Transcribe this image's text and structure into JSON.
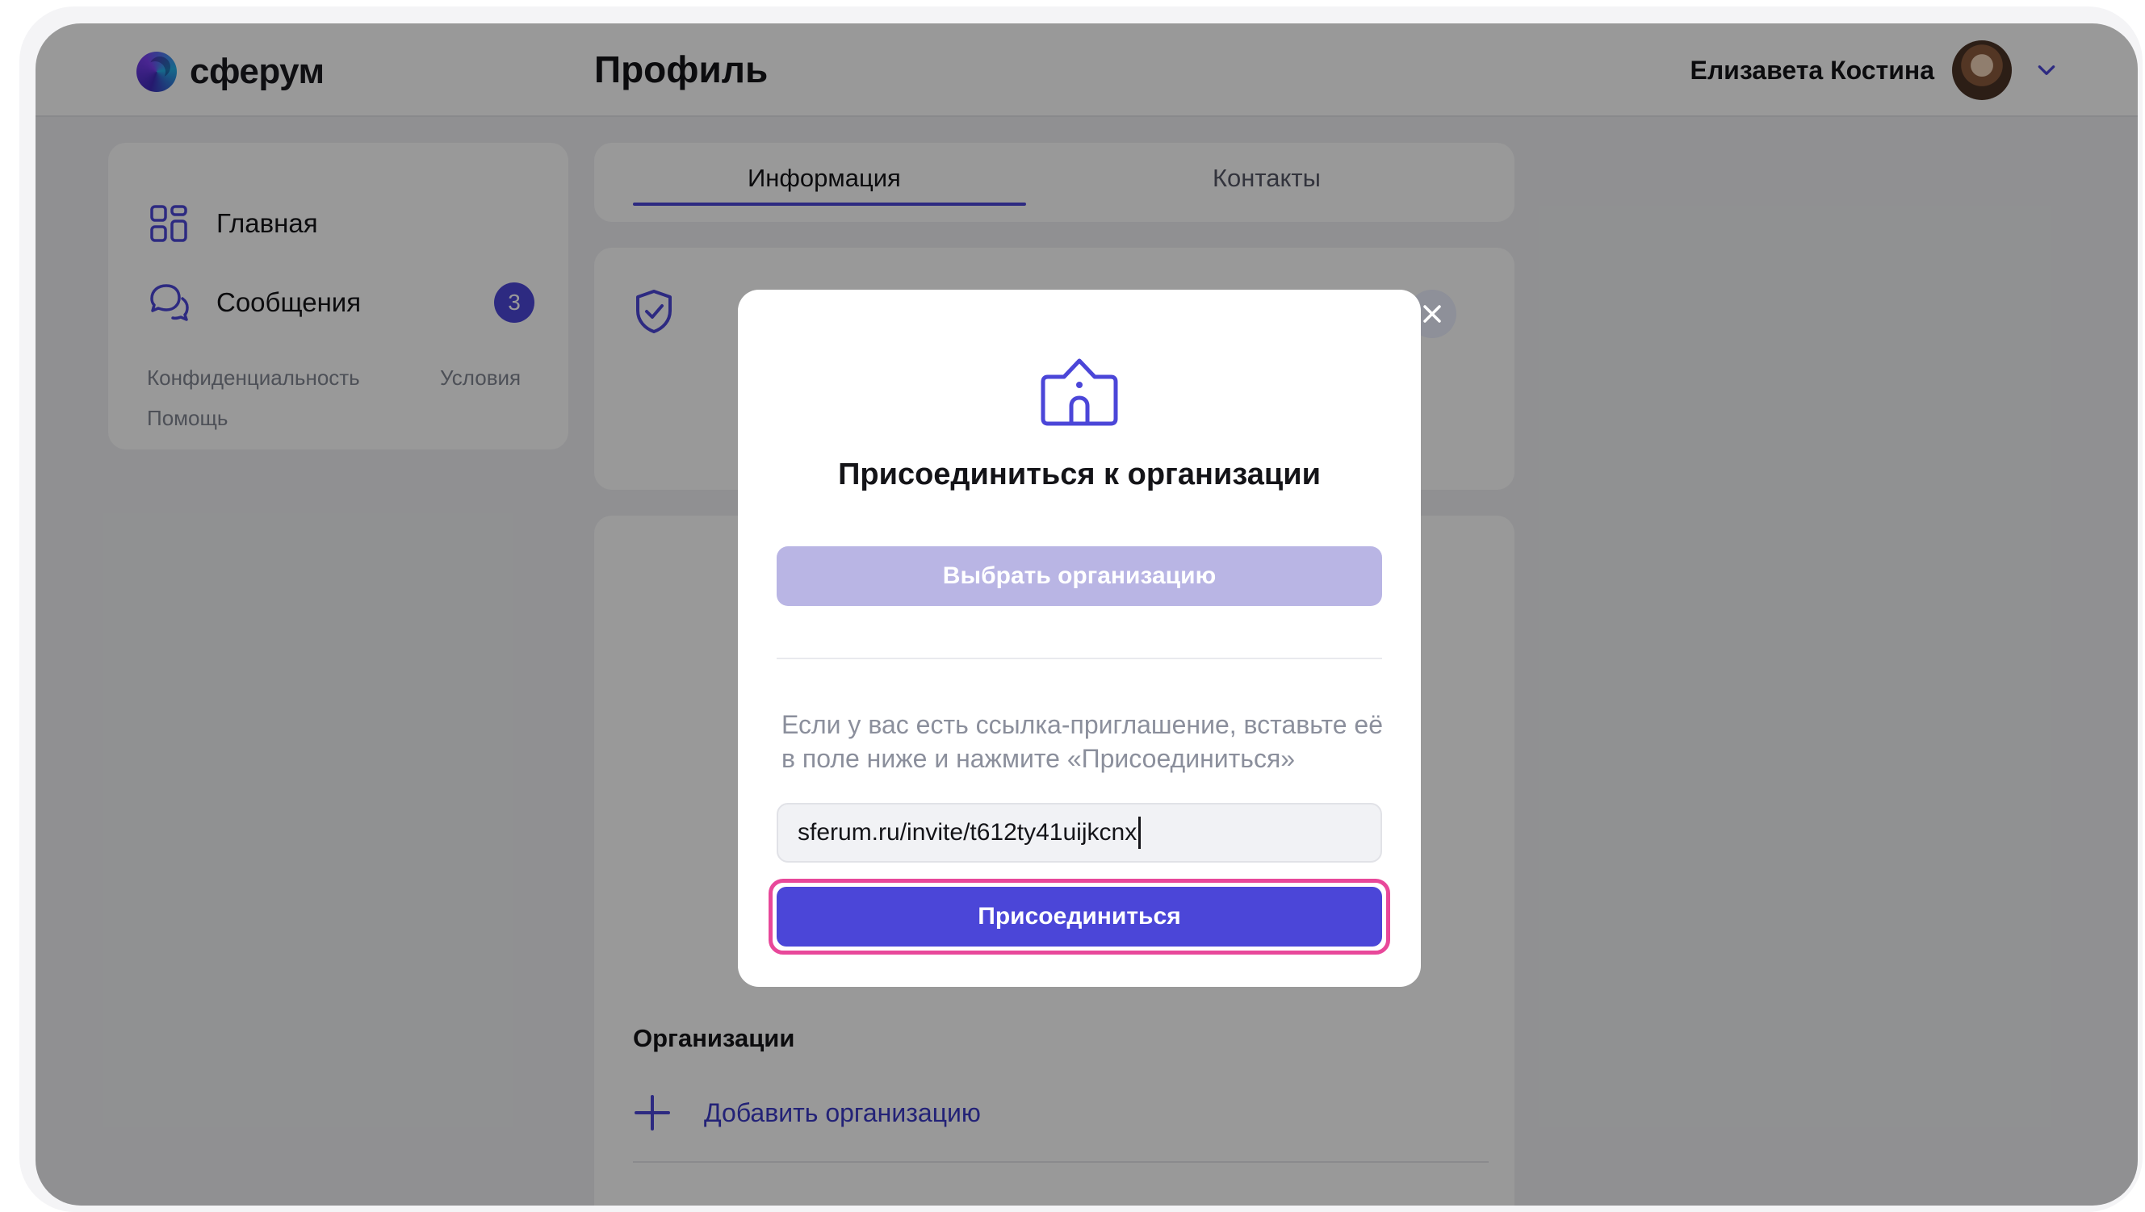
{
  "header": {
    "logo_text": "сферум",
    "page_title": "Профиль",
    "user_name": "Елизавета Костина"
  },
  "sidebar": {
    "items": [
      {
        "label": "Главная",
        "icon": "grid-icon"
      },
      {
        "label": "Сообщения",
        "icon": "chat-icon",
        "badge": "3"
      }
    ],
    "footer_links": [
      "Конфиденциальность",
      "Условия",
      "Помощь"
    ]
  },
  "tabs": [
    {
      "label": "Информация",
      "active": true
    },
    {
      "label": "Контакты",
      "active": false
    }
  ],
  "organizations": {
    "title": "Организации",
    "add_label": "Добавить организацию"
  },
  "modal": {
    "title": "Присоединиться к организации",
    "choose_button": "Выбрать организацию",
    "hint": "Если у вас есть ссылка-приглашение, вставьте её в поле ниже и нажмите «Присоединиться»",
    "invite_value": "sferum.ru/invite/t612ty41uijkcnx",
    "join_button": "Присоединиться"
  },
  "colors": {
    "accent": "#4b46d8",
    "highlight": "#e8489a",
    "disabled_button": "#b9b5e4"
  }
}
